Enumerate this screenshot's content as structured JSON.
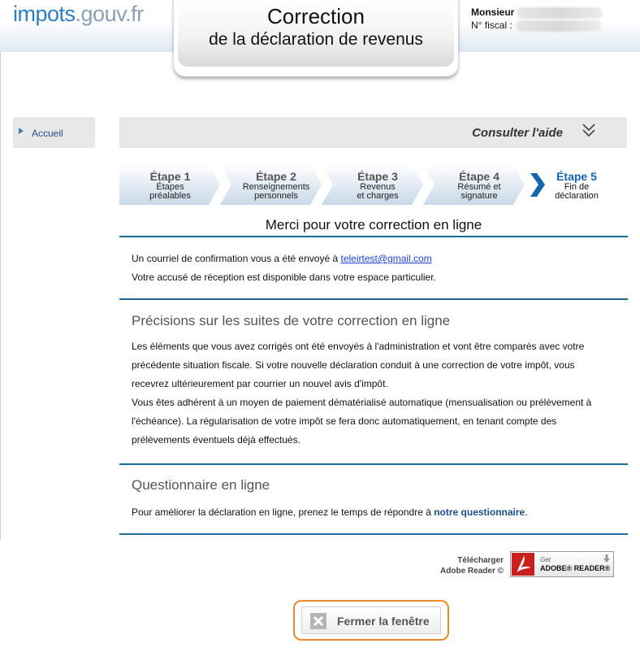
{
  "header": {
    "logo_part1": "impots",
    "logo_part2": ".gouv.fr",
    "title_line1": "Correction",
    "title_line2": "de la déclaration de revenus",
    "user_label": "Monsieur",
    "fiscal_label": "N° fiscal :"
  },
  "sidebar": {
    "home_label": "Accueil"
  },
  "help": {
    "label": "Consulter l'aide"
  },
  "steps": [
    {
      "number": "Étape 1",
      "line1": "Étapes",
      "line2": "préalables"
    },
    {
      "number": "Étape 2",
      "line1": "Renseignements",
      "line2": "personnels"
    },
    {
      "number": "Étape 3",
      "line1": "Revenus",
      "line2": "et charges"
    },
    {
      "number": "Étape 4",
      "line1": "Résumé et",
      "line2": "signature"
    },
    {
      "number": "Étape 5",
      "line1": "Fin de",
      "line2": "déclaration"
    }
  ],
  "main": {
    "title": "Merci pour votre correction en ligne",
    "confirm_prefix": "Un courriel de confirmation vous a été envoyé à ",
    "email": "teleirtest@gmail.com",
    "receipt": "Votre accusé de réception est disponible dans votre espace particulier.",
    "section1_title": "Précisions sur les suites de votre correction en ligne",
    "section1_lines": [
      "Les éléments que vous avez corrigés ont été envoyés à l'administration et vont être comparés avec votre",
      "précédente situation fiscale. Si votre nouvelle déclaration conduit à une correction de votre impôt, vous",
      "recevrez ultérieurement par courrier un nouvel avis d'impôt.",
      "Vous êtes adhérent à un moyen de paiement dématérialisé automatique (mensualisation ou prélèvement à",
      "l'échéance). La régularisation de votre impôt se fera donc automatiquement, en tenant compte des",
      "prélèvements éventuels déjà effectués."
    ],
    "section2_title": "Questionnaire en ligne",
    "survey_prefix": "Pour améliorer la déclaration en ligne, prenez le temps de répondre à ",
    "survey_link": "notre questionnaire",
    "survey_suffix": "."
  },
  "adobe": {
    "download_line1": "Télécharger",
    "download_line2": "Adobe Reader ©",
    "badge_get": "Get",
    "badge_name": "ADOBE® READER®"
  },
  "close_button": {
    "label": "Fermer la fenêtre"
  },
  "colors": {
    "accent": "#1e6a96",
    "step_active": "#1565b0",
    "close_outline": "#f08a2c"
  }
}
